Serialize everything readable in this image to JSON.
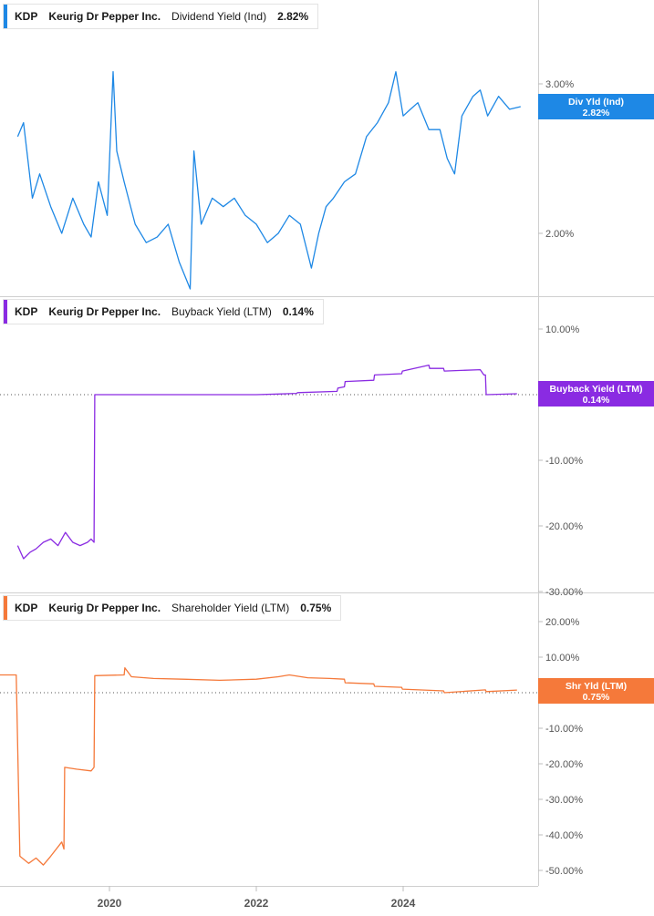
{
  "panels": [
    {
      "ticker": "KDP",
      "company": "Keurig Dr Pepper Inc.",
      "metric": "Dividend Yield (Ind)",
      "value": "2.82%",
      "tag_label": "Div Yld (Ind)",
      "tag_value": "2.82%",
      "color": "#1e88e5"
    },
    {
      "ticker": "KDP",
      "company": "Keurig Dr Pepper Inc.",
      "metric": "Buyback Yield (LTM)",
      "value": "0.14%",
      "tag_label": "Buyback Yield (LTM)",
      "tag_value": "0.14%",
      "color": "#8a2be2"
    },
    {
      "ticker": "KDP",
      "company": "Keurig Dr Pepper Inc.",
      "metric": "Shareholder Yield (LTM)",
      "value": "0.75%",
      "tag_label": "Shr Yld (LTM)",
      "tag_value": "0.75%",
      "color": "#f5793a"
    }
  ],
  "chart_data": [
    {
      "type": "line",
      "name": "Dividend Yield (Ind)",
      "y_unit": "%",
      "y_scale": "log",
      "y_ticks": [
        2.0,
        3.0
      ],
      "y_tick_labels": [
        "2.00%",
        "3.00%"
      ],
      "ylim": [
        1.6,
        3.6
      ],
      "xlim": [
        2018.7,
        2025.95
      ],
      "x_ticks": [
        2020,
        2022,
        2024
      ],
      "x_tick_labels": [
        "2020",
        "2022",
        "2024"
      ],
      "zero_line": false,
      "x": [
        2018.75,
        2018.83,
        2018.95,
        2019.05,
        2019.2,
        2019.35,
        2019.5,
        2019.65,
        2019.75,
        2019.85,
        2019.97,
        2020.05,
        2020.1,
        2020.2,
        2020.35,
        2020.5,
        2020.65,
        2020.8,
        2020.95,
        2021.1,
        2021.15,
        2021.25,
        2021.4,
        2021.55,
        2021.7,
        2021.85,
        2022.0,
        2022.15,
        2022.3,
        2022.45,
        2022.6,
        2022.75,
        2022.85,
        2022.95,
        2023.05,
        2023.2,
        2023.35,
        2023.5,
        2023.65,
        2023.8,
        2023.9,
        2024.0,
        2024.1,
        2024.2,
        2024.35,
        2024.5,
        2024.6,
        2024.7,
        2024.8,
        2024.95,
        2025.05,
        2025.15,
        2025.3,
        2025.45,
        2025.6
      ],
      "y": [
        2.6,
        2.7,
        2.2,
        2.35,
        2.15,
        2.0,
        2.2,
        2.05,
        1.98,
        2.3,
        2.1,
        3.1,
        2.5,
        2.3,
        2.05,
        1.95,
        1.98,
        2.05,
        1.85,
        1.72,
        2.5,
        2.05,
        2.2,
        2.15,
        2.2,
        2.1,
        2.05,
        1.95,
        2.0,
        2.1,
        2.05,
        1.82,
        2.0,
        2.15,
        2.2,
        2.3,
        2.35,
        2.6,
        2.7,
        2.85,
        3.1,
        2.75,
        2.8,
        2.85,
        2.65,
        2.65,
        2.45,
        2.35,
        2.75,
        2.9,
        2.95,
        2.75,
        2.9,
        2.8,
        2.82
      ]
    },
    {
      "type": "line",
      "name": "Buyback Yield (LTM)",
      "y_unit": "%",
      "y_ticks": [
        10,
        0,
        -10,
        -20,
        -30
      ],
      "y_tick_labels": [
        "10.00%",
        "0.00%",
        "-10.00%",
        "-20.00%",
        "-30.00%"
      ],
      "ylim": [
        -30,
        13
      ],
      "xlim": [
        2018.7,
        2025.95
      ],
      "zero_line": true,
      "x": [
        2018.75,
        2018.83,
        2018.92,
        2019.0,
        2019.1,
        2019.2,
        2019.3,
        2019.4,
        2019.5,
        2019.6,
        2019.7,
        2019.75,
        2019.79,
        2019.8,
        2020.2,
        2020.6,
        2021.0,
        2021.5,
        2022.0,
        2022.3,
        2022.55,
        2022.56,
        2023.1,
        2023.11,
        2023.2,
        2023.21,
        2023.6,
        2023.61,
        2023.98,
        2023.99,
        2024.35,
        2024.36,
        2024.55,
        2024.56,
        2025.05,
        2025.1,
        2025.12,
        2025.13,
        2025.55
      ],
      "y": [
        -23.0,
        -25.0,
        -24.0,
        -23.5,
        -22.5,
        -22.0,
        -23.0,
        -21.0,
        -22.5,
        -23.0,
        -22.5,
        -22.0,
        -22.5,
        0.0,
        0.0,
        0.0,
        0.0,
        0.0,
        0.0,
        0.1,
        0.2,
        0.3,
        0.5,
        1.0,
        1.2,
        2.0,
        2.2,
        3.0,
        3.2,
        3.6,
        4.5,
        4.0,
        4.0,
        3.6,
        3.8,
        3.0,
        3.0,
        0.0,
        0.14
      ]
    },
    {
      "type": "line",
      "name": "Shareholder Yield (LTM)",
      "y_unit": "%",
      "y_ticks": [
        20,
        10,
        0,
        -10,
        -20,
        -30,
        -40,
        -50
      ],
      "y_tick_labels": [
        "20.00%",
        "10.00%",
        "0.00%",
        "-10.00%",
        "-20.00%",
        "-30.00%",
        "-40.00%",
        "-50.00%"
      ],
      "ylim": [
        -54,
        25
      ],
      "xlim": [
        2018.7,
        2025.95
      ],
      "zero_line": true,
      "x": [
        2018.4,
        2018.7,
        2018.73,
        2018.78,
        2018.9,
        2019.0,
        2019.1,
        2019.2,
        2019.35,
        2019.38,
        2019.39,
        2019.55,
        2019.75,
        2019.79,
        2019.8,
        2020.2,
        2020.21,
        2020.3,
        2020.6,
        2021.0,
        2021.5,
        2022.0,
        2022.3,
        2022.45,
        2022.7,
        2023.0,
        2023.2,
        2023.21,
        2023.6,
        2023.61,
        2023.98,
        2023.99,
        2024.55,
        2024.56,
        2025.12,
        2025.13,
        2025.55
      ],
      "y": [
        5.0,
        5.0,
        5.0,
        -46.0,
        -48.0,
        -46.5,
        -48.5,
        -46.0,
        -42.0,
        -44.0,
        -21.0,
        -21.5,
        -22.0,
        -21.0,
        4.8,
        5.0,
        7.0,
        4.5,
        4.0,
        3.8,
        3.5,
        3.8,
        4.5,
        5.0,
        4.2,
        4.0,
        3.8,
        2.8,
        2.5,
        1.8,
        1.5,
        1.0,
        0.5,
        0.0,
        0.8,
        0.3,
        0.75
      ]
    }
  ]
}
